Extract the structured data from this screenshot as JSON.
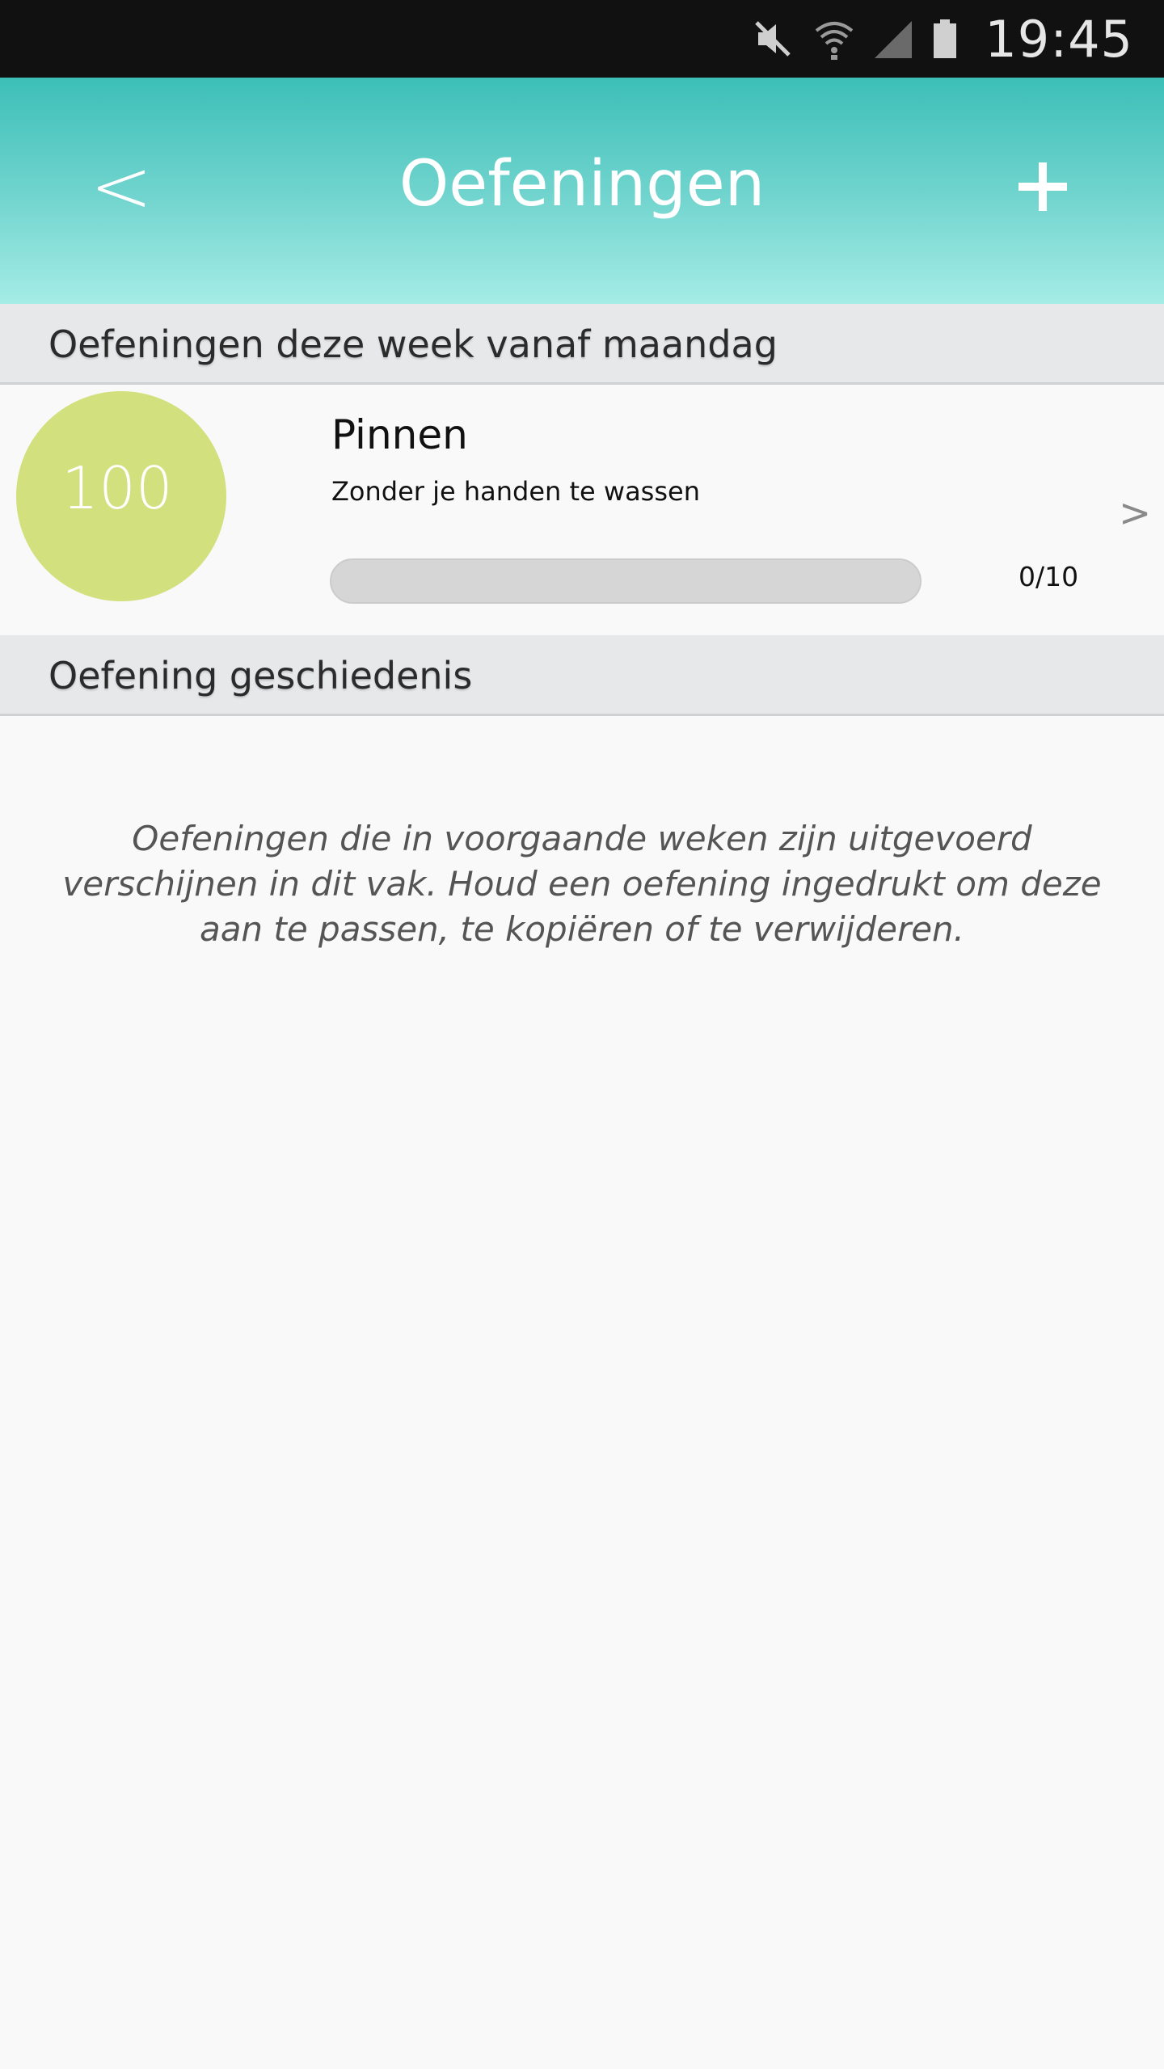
{
  "status_bar": {
    "time": "19:45",
    "icons": [
      "mute-icon",
      "wifi-icon",
      "signal-icon",
      "battery-icon"
    ]
  },
  "header": {
    "title": "Oefeningen",
    "back_label": "<",
    "add_icon": "plus-icon",
    "colors": {
      "gradient_top": "#3cbfb8",
      "gradient_bottom": "#a5ece6"
    }
  },
  "current_week": {
    "section_title": "Oefeningen deze week vanaf maandag",
    "exercises": [
      {
        "score": "100",
        "name": "Pinnen",
        "description": "Zonder je handen te wassen",
        "progress_text": "0/10",
        "progress_fraction": 0,
        "chevron": ">",
        "circle_color": "#d2e07d"
      }
    ]
  },
  "history": {
    "section_title": "Oefening geschiedenis",
    "empty_message": "Oefeningen die in voorgaande weken zijn uitgevoerd verschijnen in dit vak. Houd een oefening ingedrukt om deze aan te passen, te kopiëren of te verwijderen."
  }
}
